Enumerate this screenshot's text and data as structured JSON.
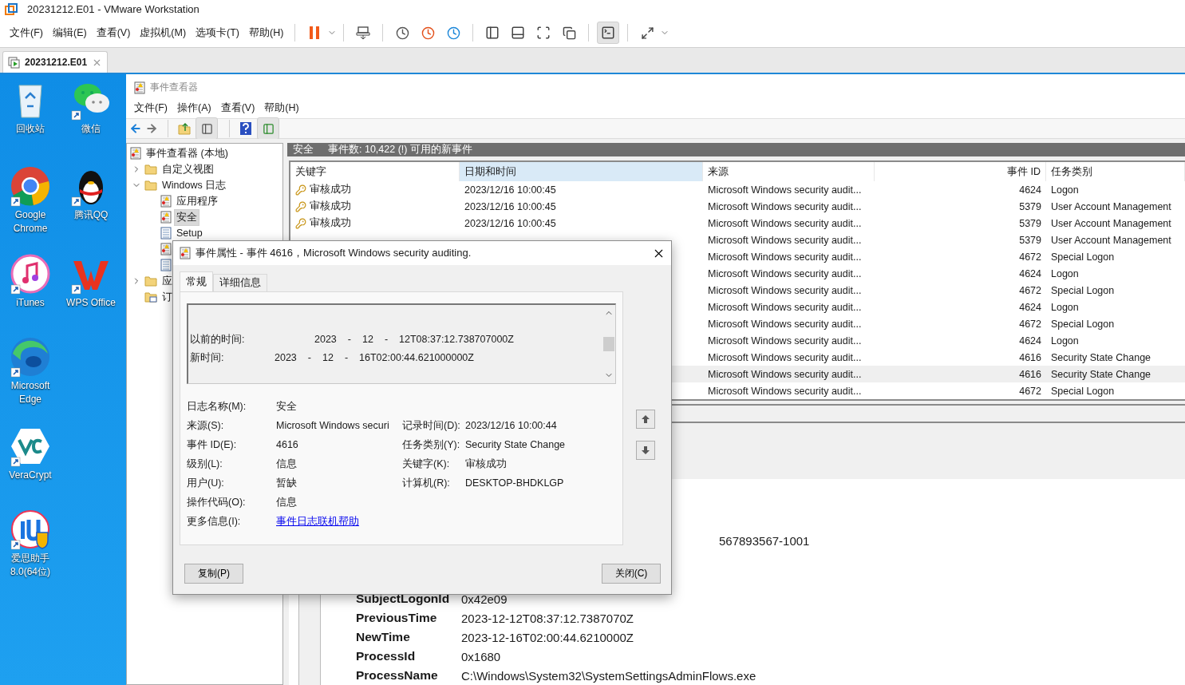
{
  "window": {
    "title": "20231212.E01 - VMware Workstation"
  },
  "menu": [
    "文件(F)",
    "编辑(E)",
    "查看(V)",
    "虚拟机(M)",
    "选项卡(T)",
    "帮助(H)"
  ],
  "vm_tab": {
    "label": "20231212.E01",
    "selected": true
  },
  "desktop_icons": [
    {
      "label": "回收站",
      "kind": "recycle"
    },
    {
      "label": "微信",
      "kind": "chat"
    },
    {
      "label": "Google Chrome",
      "kind": "browser"
    },
    {
      "label": "腾讯QQ",
      "kind": "penguin"
    },
    {
      "label": "iTunes",
      "kind": "music"
    },
    {
      "label": "WPS Office",
      "kind": "office"
    },
    {
      "label": "Microsoft Edge",
      "kind": "wave"
    },
    {
      "kind": "none"
    },
    {
      "label": "VeraCrypt",
      "kind": "hexagon"
    },
    {
      "kind": "none"
    },
    {
      "label": "爱思助手 8.0(64位)",
      "kind": "helper"
    }
  ],
  "event_viewer": {
    "title": "事件查看器",
    "menu": [
      "文件(F)",
      "操作(A)",
      "查看(V)",
      "帮助(H)"
    ],
    "tree": {
      "label": "事件查看器 (本地)",
      "kind": "root",
      "children": [
        {
          "label": "自定义视图",
          "kind": "folder",
          "expanded": false
        },
        {
          "label": "Windows 日志",
          "kind": "folder",
          "expanded": true,
          "children": [
            {
              "label": "应用程序",
              "kind": "log",
              "selected": false
            },
            {
              "label": "安全",
              "kind": "log",
              "selected": true
            },
            {
              "label": "Setup",
              "kind": "plain",
              "selected": false
            },
            {
              "kind": "log"
            },
            {
              "kind": "plain"
            }
          ]
        },
        {
          "label": "应",
          "kind": "folder",
          "expanded": false
        },
        {
          "label": "订",
          "kind": "subscription"
        }
      ]
    },
    "log_header": {
      "name": "安全",
      "summary": "事件数: 10,422 (!) 可用的新事件"
    },
    "table": {
      "columns": [
        {
          "label": "关键字",
          "selected": false
        },
        {
          "label": "日期和时间",
          "selected": true
        },
        {
          "label": "来源",
          "selected": false
        },
        {
          "label": "事件 ID",
          "selected": false
        },
        {
          "label": "任务类别",
          "selected": false
        }
      ],
      "rows": [
        {
          "keyword": "审核成功",
          "date": "2023/12/16 10:00:45",
          "source": "Microsoft Windows security audit...",
          "event_id": "4624",
          "category": "Logon",
          "selected": false
        },
        {
          "keyword": "审核成功",
          "date": "2023/12/16 10:00:45",
          "source": "Microsoft Windows security audit...",
          "event_id": "5379",
          "category": "User Account Management",
          "selected": false
        },
        {
          "keyword": "审核成功",
          "date": "2023/12/16 10:00:45",
          "source": "Microsoft Windows security audit...",
          "event_id": "5379",
          "category": "User Account Management",
          "selected": false
        },
        {
          "source": "Microsoft Windows security audit...",
          "event_id": "5379",
          "category": "User Account Management",
          "selected": false
        },
        {
          "source": "Microsoft Windows security audit...",
          "event_id": "4672",
          "category": "Special Logon",
          "selected": false
        },
        {
          "source": "Microsoft Windows security audit...",
          "event_id": "4624",
          "category": "Logon",
          "selected": false
        },
        {
          "source": "Microsoft Windows security audit...",
          "event_id": "4672",
          "category": "Special Logon",
          "selected": false
        },
        {
          "source": "Microsoft Windows security audit...",
          "event_id": "4624",
          "category": "Logon",
          "selected": false
        },
        {
          "source": "Microsoft Windows security audit...",
          "event_id": "4672",
          "category": "Special Logon",
          "selected": false
        },
        {
          "source": "Microsoft Windows security audit...",
          "event_id": "4624",
          "category": "Logon",
          "selected": false
        },
        {
          "source": "Microsoft Windows security audit...",
          "event_id": "4616",
          "category": "Security State Change",
          "selected": false
        },
        {
          "source": "Microsoft Windows security audit...",
          "event_id": "4616",
          "category": "Security State Change",
          "selected": true
        },
        {
          "source": "Microsoft Windows security audit...",
          "event_id": "4672",
          "category": "Special Logon",
          "selected": false
        }
      ]
    },
    "details": {
      "partial": "567893567-1001",
      "rows": [
        {
          "label": "SubjectLogonId",
          "value": "0x42e09"
        },
        {
          "label": "PreviousTime",
          "value": "2023-12-12T08:37:12.7387070Z"
        },
        {
          "label": "NewTime",
          "value": "2023-12-16T02:00:44.6210000Z"
        },
        {
          "label": "ProcessId",
          "value": "0x1680"
        },
        {
          "label": "ProcessName",
          "value": "C:\\Windows\\System32\\SystemSettingsAdminFlows.exe"
        }
      ]
    }
  },
  "dialog": {
    "title": "事件属性 - 事件 4616，Microsoft Windows security auditing.",
    "tabs": [
      {
        "label": "常规",
        "selected": true
      },
      {
        "label": "详细信息",
        "selected": false
      }
    ],
    "description": [
      {
        "label": "以前的时间:",
        "parts": [
          "2023",
          "-",
          "12",
          "-",
          "12T08:37:12.738707000Z"
        ]
      },
      {
        "label": "新时间:",
        "parts": [
          "2023",
          "-",
          "12",
          "-",
          "16T02:00:44.621000000Z"
        ]
      }
    ],
    "fields": [
      {
        "left": {
          "label": "日志名称(M):",
          "value": "安全"
        }
      },
      {
        "left": {
          "label": "来源(S):",
          "value": "Microsoft Windows securi"
        },
        "right": {
          "label": "记录时间(D):",
          "value": "2023/12/16 10:00:44"
        }
      },
      {
        "left": {
          "label": "事件 ID(E):",
          "value": "4616"
        },
        "right": {
          "label": "任务类别(Y):",
          "value": "Security State Change"
        }
      },
      {
        "left": {
          "label": "级别(L):",
          "value": "信息"
        },
        "right": {
          "label": "关键字(K):",
          "value": "审核成功"
        }
      },
      {
        "left": {
          "label": "用户(U):",
          "value": "暂缺"
        },
        "right": {
          "label": "计算机(R):",
          "value": "DESKTOP-BHDKLGP"
        }
      },
      {
        "left": {
          "label": "操作代码(O):",
          "value": "信息"
        }
      },
      {
        "left": {
          "label": "更多信息(I):",
          "value": "事件日志联机帮助",
          "kind": "link"
        }
      }
    ],
    "buttons": [
      "复制(P)",
      "关闭(C)"
    ]
  }
}
